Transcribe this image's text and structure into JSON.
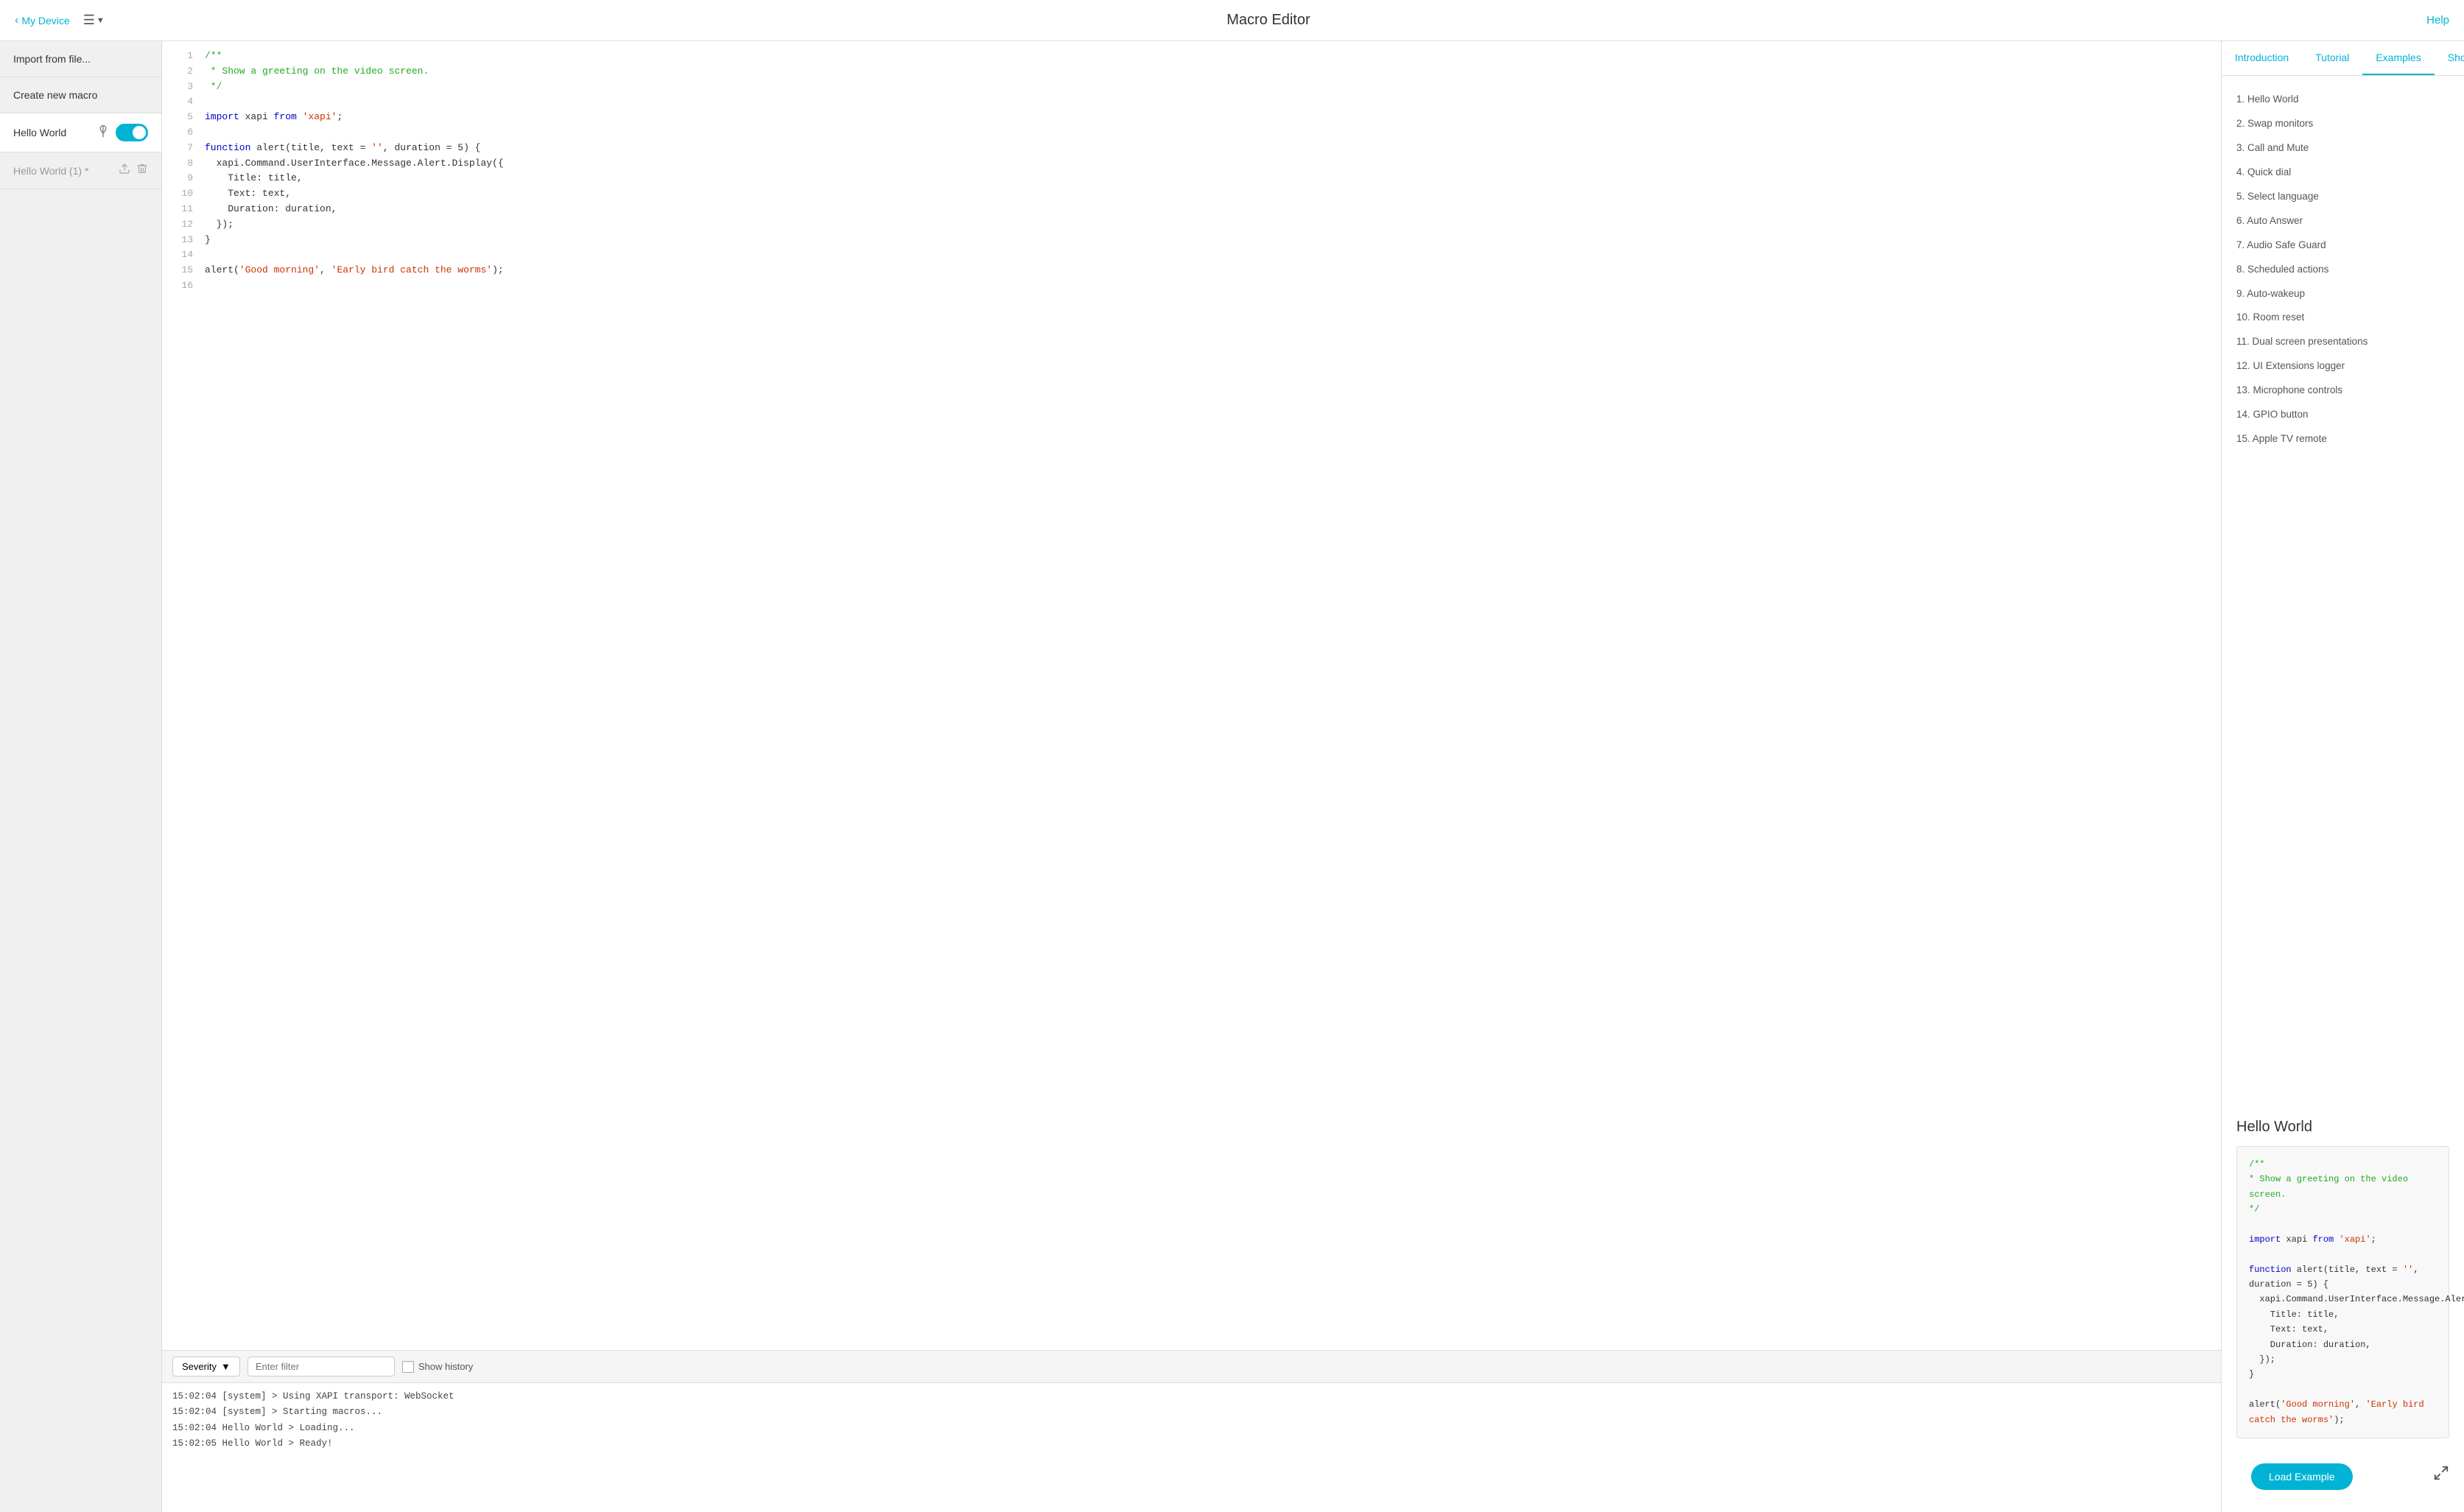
{
  "topbar": {
    "back_label": "My Device",
    "title": "Macro Editor",
    "help_label": "Help"
  },
  "sidebar": {
    "import_label": "Import from file...",
    "create_label": "Create new macro",
    "macros": [
      {
        "name": "Hello World",
        "enabled": true
      },
      {
        "name": "Hello World (1) *",
        "draft": true
      }
    ]
  },
  "editor": {
    "lines": [
      {
        "num": "1",
        "code": "/**",
        "type": "comment"
      },
      {
        "num": "2",
        "code": " * Show a greeting on the video screen.",
        "type": "comment"
      },
      {
        "num": "3",
        "code": " */",
        "type": "comment"
      },
      {
        "num": "4",
        "code": "",
        "type": "normal"
      },
      {
        "num": "5",
        "code": "import xapi from 'xapi';",
        "type": "import"
      },
      {
        "num": "6",
        "code": "",
        "type": "normal"
      },
      {
        "num": "7",
        "code": "function alert(title, text = '', duration = 5) {",
        "type": "function"
      },
      {
        "num": "8",
        "code": "  xapi.Command.UserInterface.Message.Alert.Display({",
        "type": "normal"
      },
      {
        "num": "9",
        "code": "    Title: title,",
        "type": "normal"
      },
      {
        "num": "10",
        "code": "    Text: text,",
        "type": "normal"
      },
      {
        "num": "11",
        "code": "    Duration: duration,",
        "type": "normal"
      },
      {
        "num": "12",
        "code": "  });",
        "type": "normal"
      },
      {
        "num": "13",
        "code": "}",
        "type": "normal"
      },
      {
        "num": "14",
        "code": "",
        "type": "normal"
      },
      {
        "num": "15",
        "code": "alert('Good morning', 'Early bird catch the worms');",
        "type": "call"
      },
      {
        "num": "16",
        "code": "",
        "type": "normal"
      }
    ]
  },
  "log": {
    "severity_label": "Severity",
    "filter_placeholder": "Enter filter",
    "show_history_label": "Show history",
    "lines": [
      "15:02:04  [system]      >  Using XAPI transport: WebSocket",
      "15:02:04  [system]      >  Starting macros...",
      "15:02:04  Hello World  >  Loading...",
      "15:02:05  Hello World  >  Ready!"
    ]
  },
  "right_panel": {
    "tabs": [
      "Introduction",
      "Tutorial",
      "Examples",
      "Shortcuts"
    ],
    "active_tab": "Examples",
    "examples": [
      "1. Hello World",
      "2. Swap monitors",
      "3. Call and Mute",
      "4. Quick dial",
      "5. Select language",
      "6. Auto Answer",
      "7. Audio Safe Guard",
      "8. Scheduled actions",
      "9. Auto-wakeup",
      "10. Room reset",
      "11. Dual screen presentations",
      "12. UI Extensions logger",
      "13. Microphone controls",
      "14. GPIO button",
      "15. Apple TV remote"
    ],
    "hello_world": {
      "title": "Hello World",
      "code_comment1": "/**",
      "code_comment2": " * Show a greeting on the video screen.",
      "code_comment3": " */",
      "code_import": "import xapi from 'xapi';",
      "code_function": "function alert(title, text = '', duration = 5) {",
      "code_body1": "  xapi.Command.UserInterface.Message.Alert.Display({",
      "code_body2": "    Title: title,",
      "code_body3": "    Text: text,",
      "code_body4": "    Duration: duration,",
      "code_body5": "  });",
      "code_close": "}",
      "code_call": "alert('Good morning', 'Early bird catch the worms');",
      "load_btn": "Load Example"
    }
  }
}
